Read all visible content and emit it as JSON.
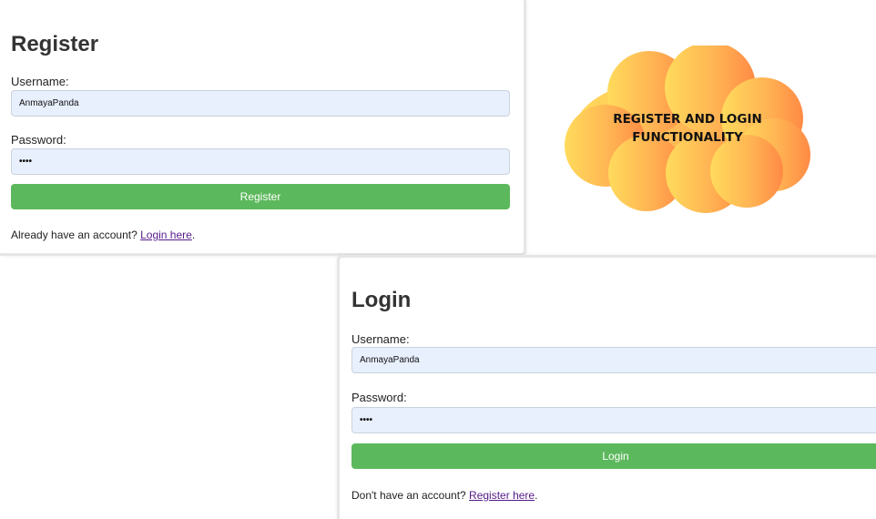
{
  "register": {
    "title": "Register",
    "username_label": "Username:",
    "username_value": "AnmayaPanda",
    "password_label": "Password:",
    "password_masked": "••••",
    "submit_label": "Register",
    "footer_prefix": "Already have an account? ",
    "footer_link": "Login here",
    "footer_suffix": "."
  },
  "login": {
    "title": "Login",
    "username_label": "Username:",
    "username_value": "AnmayaPanda",
    "password_label": "Password:",
    "password_masked": "••••",
    "submit_label": "Login",
    "footer_prefix": "Don't have an account? ",
    "footer_link": "Register here",
    "footer_suffix": "."
  },
  "banner": {
    "line1": "REGISTER AND LOGIN",
    "line2": "FUNCTIONALITY"
  },
  "colors": {
    "button_green": "#5cb85c",
    "input_fill": "#e8f0fe",
    "link_visited": "#551a8b",
    "cloud_gradient_start": "#ffd95a",
    "cloud_gradient_end": "#ff8a45"
  }
}
